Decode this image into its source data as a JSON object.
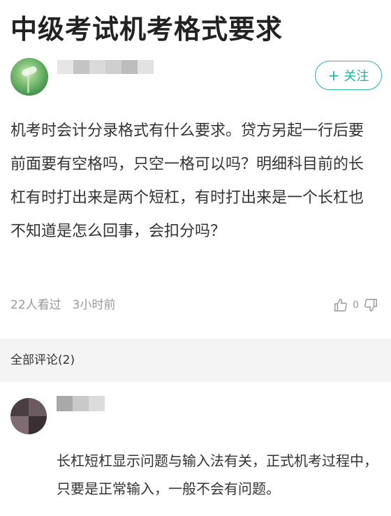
{
  "article": {
    "title": "中级考试机考格式要求",
    "question": "机考时会计分录格式有什么要求。贷方另起一行后要前面要有空格吗，只空一格可以吗？明细科目前的长杠有时打出来是两个短杠，有时打出来是一个长杠也不知道是怎么回事，会扣分吗？",
    "views": "22人看过",
    "time": "3小时前",
    "like_count": "0"
  },
  "author": {
    "follow_plus": "+",
    "follow_label": "关注"
  },
  "comments": {
    "header": "全部评论(2)",
    "items": [
      {
        "text": "长杠短杠显示问题与输入法有关，正式机考过程中，只要是正常输入，一般不会有问题。"
      }
    ]
  },
  "colors": {
    "accent": "#1fb3a3",
    "section_bg": "#f4f4f4",
    "meta_text": "#999999"
  }
}
